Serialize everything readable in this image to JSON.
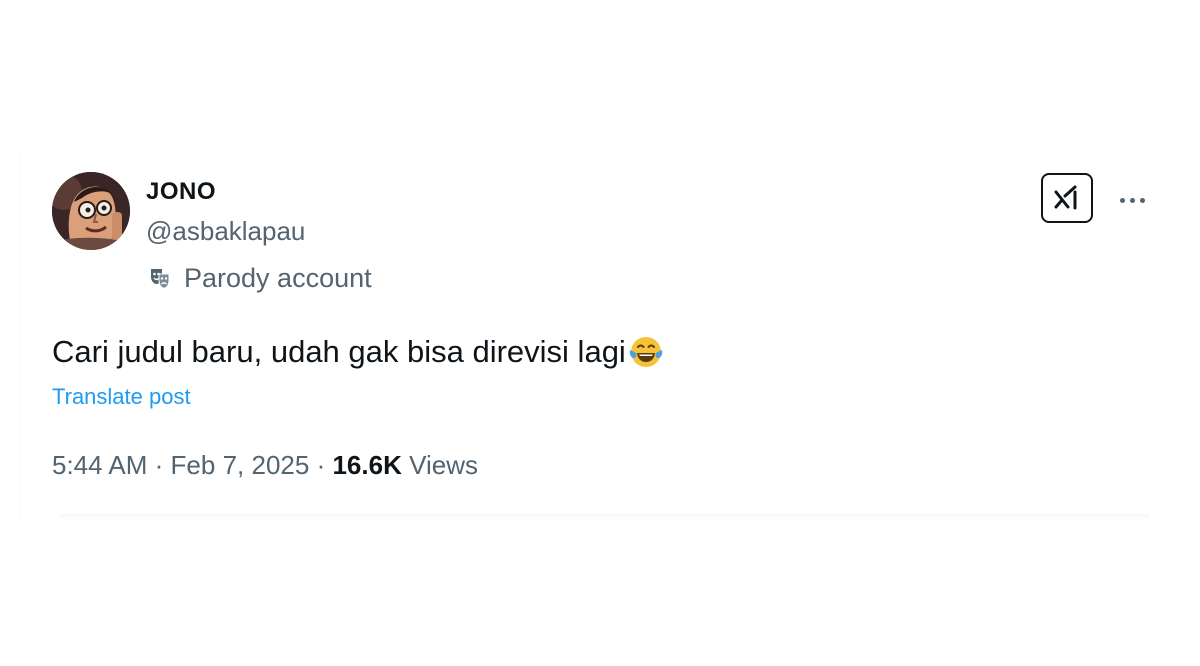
{
  "tweet": {
    "author": {
      "display_name": "JONO",
      "handle": "@asbaklapau",
      "label": "Parody account",
      "label_icon": "theater-masks-icon",
      "avatar_icon": "cartoon-face-avatar"
    },
    "text": "Cari judul baru, udah gak bisa direvisi lagi",
    "emoji": "face-with-tears-of-joy",
    "translate_label": "Translate post",
    "time": "5:44 AM",
    "separator": "·",
    "date": "Feb 7, 2025",
    "views_count": "16.6K",
    "views_label": "Views"
  },
  "actions": {
    "grok_icon": "grok-icon",
    "more_icon": "more-dots-icon"
  },
  "colors": {
    "primary_text": "#0f1419",
    "secondary_text": "#536471",
    "link": "#1d9bf0",
    "background": "#ffffff"
  }
}
